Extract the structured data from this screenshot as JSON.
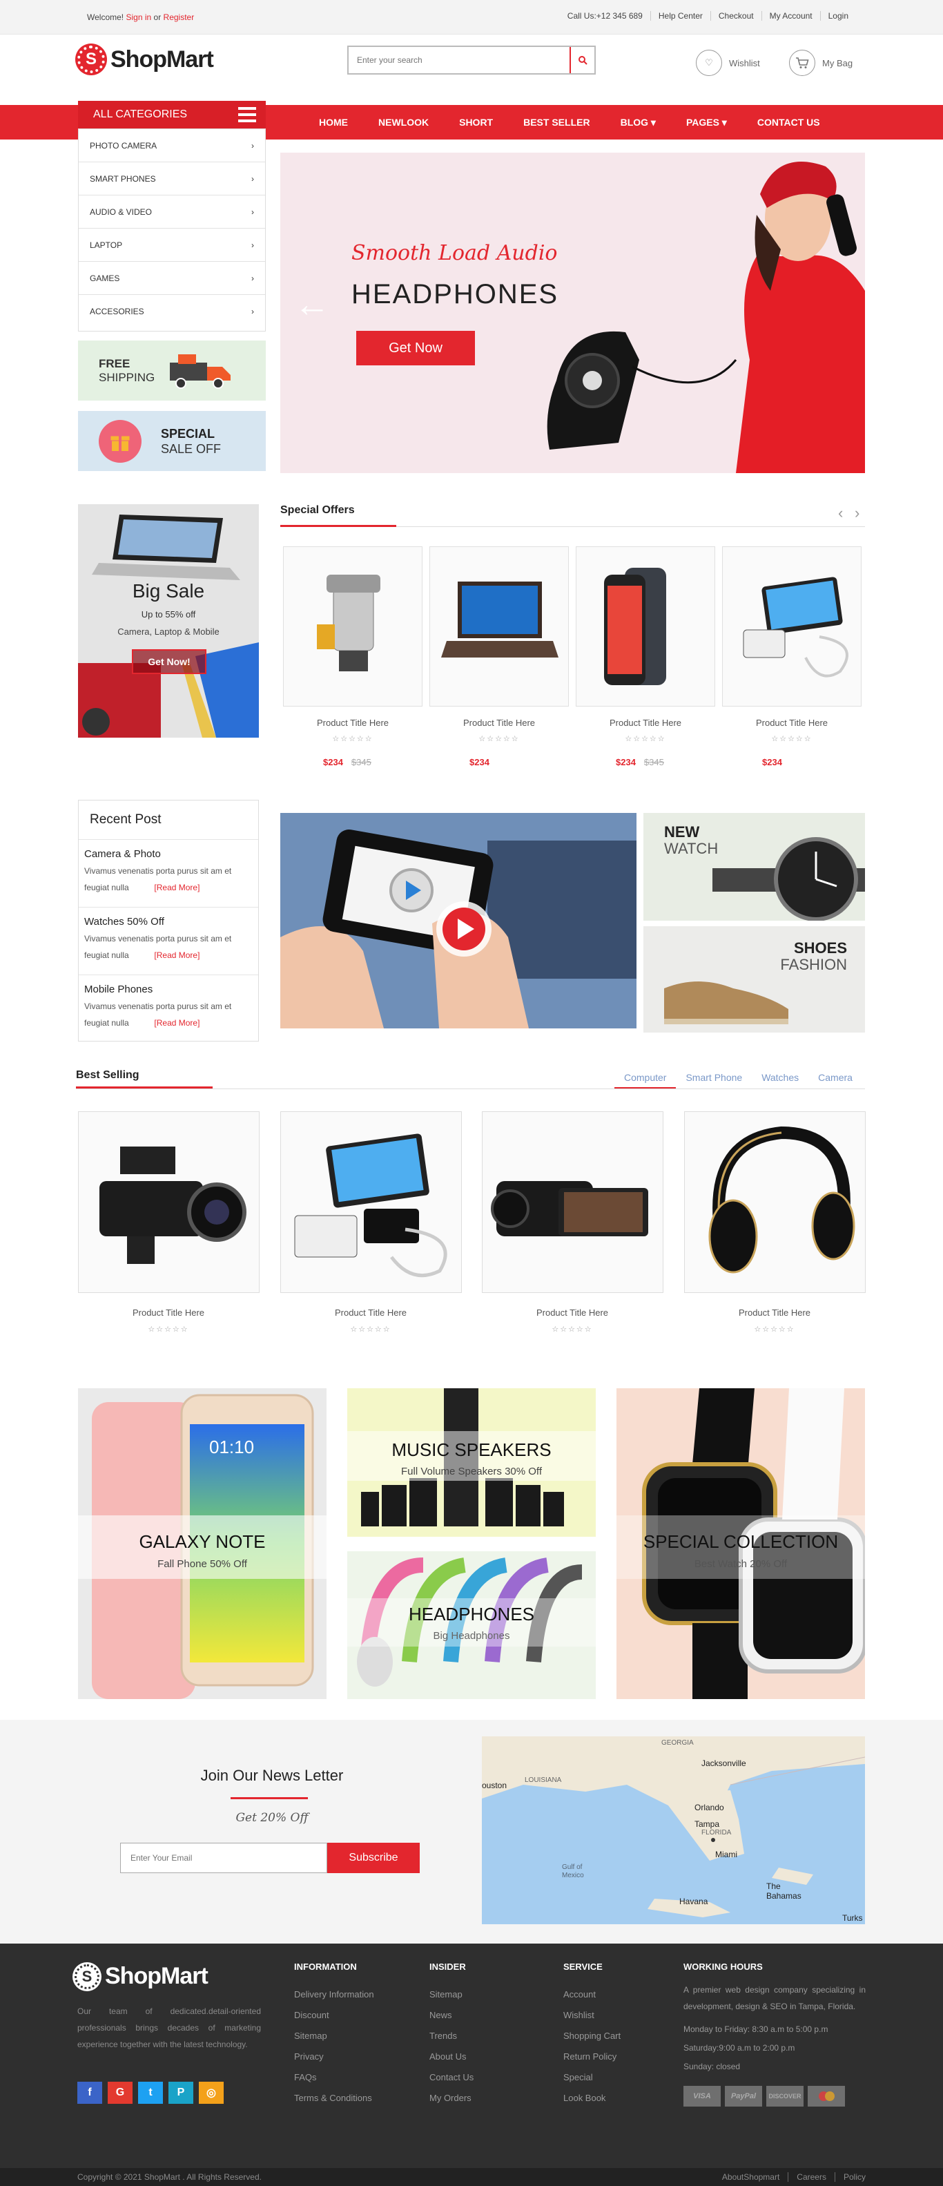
{
  "topbar": {
    "welcome_prefix": "Welcome!",
    "sign_in": "Sign in",
    "or": "or",
    "register": "Register",
    "links": [
      "Call Us:+12 345 689",
      "Help Center",
      "Checkout",
      "My Account",
      "Login"
    ]
  },
  "header": {
    "logo_part1": "Shop",
    "logo_part2": "Mart",
    "logo_glyph": "S",
    "search_placeholder": "Enter your search",
    "wishlist": "Wishlist",
    "bag": "My Bag"
  },
  "nav": {
    "all_categories": "ALL CATEGORIES",
    "links": [
      "HOME",
      "NEWLOOK",
      "SHORT",
      "BEST SELLER",
      "BLOG ▾",
      "PAGES ▾",
      "CONTACT US"
    ]
  },
  "categories": [
    "PHOTO CAMERA",
    "SMART PHONES",
    "AUDIO & VIDEO",
    "LAPTOP",
    "GAMES",
    "ACCESORIES"
  ],
  "promos": {
    "free_line1": "FREE",
    "free_line2": "SHIPPING",
    "special_line1": "SPECIAL",
    "special_line2": "SALE OFF"
  },
  "hero": {
    "subtitle": "Smooth Load Audio",
    "title": "HEADPHONES",
    "cta": "Get Now"
  },
  "bigsale": {
    "title": "Big Sale",
    "line1": "Up to 55% off",
    "line2": "Camera, Laptop & Mobile",
    "cta": "Get Now!"
  },
  "special_offers": {
    "title": "Special Offers",
    "products": [
      {
        "title": "Product Title Here",
        "stars": "☆☆☆☆☆",
        "price": "$234",
        "old": "$345"
      },
      {
        "title": "Product Title Here",
        "stars": "☆☆☆☆☆",
        "price": "$234",
        "old": ""
      },
      {
        "title": "Product Title Here",
        "stars": "☆☆☆☆☆",
        "price": "$234",
        "old": "$345"
      },
      {
        "title": "Product Title Here",
        "stars": "☆☆☆☆☆",
        "price": "$234",
        "old": ""
      }
    ]
  },
  "recent": {
    "title": "Recent Post",
    "posts": [
      {
        "title": "Camera & Photo",
        "desc": "Vivamus venenatis porta purus sit am et feugiat nulla",
        "more": "[Read More]"
      },
      {
        "title": "Watches 50% Off",
        "desc": "Vivamus venenatis porta purus sit am et feugiat nulla",
        "more": "[Read More]"
      },
      {
        "title": "Mobile Phones",
        "desc": "Vivamus venenatis porta purus sit am et feugiat nulla",
        "more": "[Read More]"
      }
    ]
  },
  "minibanners": {
    "watch_line1": "NEW",
    "watch_line2": "WATCH",
    "shoes_line1": "SHOES",
    "shoes_line2": "FASHION"
  },
  "bestselling": {
    "title": "Best Selling",
    "tabs": [
      "Computer",
      "Smart Phone",
      "Watches",
      "Camera"
    ],
    "products": [
      {
        "title": "Product Title Here",
        "stars": "☆☆☆☆☆"
      },
      {
        "title": "Product Title Here",
        "stars": "☆☆☆☆☆"
      },
      {
        "title": "Product Title Here",
        "stars": "☆☆☆☆☆"
      },
      {
        "title": "Product Title Here",
        "stars": "☆☆☆☆☆"
      }
    ]
  },
  "banners": {
    "galaxy_title": "GALAXY NOTE",
    "galaxy_sub": "Fall Phone 50% Off",
    "phone_time": "01:10",
    "music_title": "MUSIC SPEAKERS",
    "music_sub": "Full Volume Speakers 30% Off",
    "head_title": "HEADPHONES",
    "head_sub": "Big Headphones",
    "special_title": "SPECIAL COLLECTION",
    "special_sub": "Best Watch 20% Off"
  },
  "newsletter": {
    "title": "Join Our News Letter",
    "sub": "Get 20% Off",
    "placeholder": "Enter Your Email",
    "button": "Subscribe"
  },
  "map": {
    "labels": [
      "GEORGIA",
      "Jacksonville",
      "ouston",
      "LOUISIANA",
      "Orlando",
      "Tampa",
      "FLORIDA",
      "Miami",
      "Gulf of Mexico",
      "The Bahamas",
      "Havana",
      "Turks"
    ]
  },
  "footer": {
    "about": "Our team of dedicated.detail-oriented professionals brings decades of marketing experience together with the latest technology.",
    "socials": [
      "f",
      "G",
      "t",
      "P",
      "◎"
    ],
    "columns": [
      {
        "title": "INFORMATION",
        "items": [
          "Delivery Information",
          "Discount",
          "Sitemap",
          "Privacy",
          "FAQs",
          "Terms & Conditions"
        ]
      },
      {
        "title": "INSIDER",
        "items": [
          "Sitemap",
          "News",
          "Trends",
          "About Us",
          "Contact Us",
          "My Orders"
        ]
      },
      {
        "title": "SERVICE",
        "items": [
          "Account",
          "Wishlist",
          "Shopping Cart",
          "Return Policy",
          "Special",
          "Look Book"
        ]
      }
    ],
    "hours_title": "WORKING HOURS",
    "hours_desc": "A premier web design company specializing in development, design & SEO in Tampa, Florida.",
    "hours": [
      "Monday to Friday: 8:30 a.m to 5:00 p.m",
      "Saturday:9:00 a.m to 2:00 p.m",
      "Sunday: closed"
    ],
    "payments": [
      "VISA",
      "PayPal",
      "DISCOVER",
      "MC"
    ]
  },
  "copyright": {
    "text": "Copyright © 2021 ShopMart . All Rights Reserved.",
    "links": [
      "AboutShopmart",
      "Careers",
      "Policy"
    ]
  },
  "colors": {
    "accent": "#e3262e",
    "footer": "#2f2f2f"
  }
}
